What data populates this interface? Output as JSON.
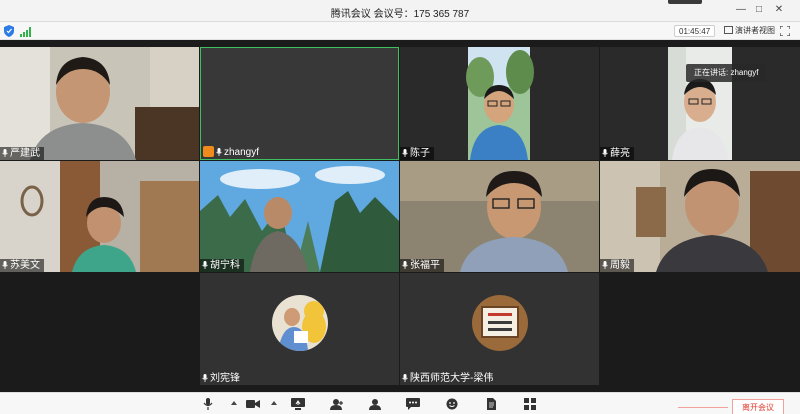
{
  "window": {
    "title": "腾讯会议 会议号：175 365 787"
  },
  "status": {
    "timer": "01:45:47",
    "speaker_view_label": "演讲者视图"
  },
  "speaking_indicator": "正在讲话: zhangyf",
  "participants": [
    {
      "name": "严建武"
    },
    {
      "name": "zhangyf"
    },
    {
      "name": "陈子"
    },
    {
      "name": "薛亮"
    },
    {
      "name": "苏美文"
    },
    {
      "name": "胡宁科"
    },
    {
      "name": "张福平"
    },
    {
      "name": "周毅"
    },
    {
      "name": "刘宪锋"
    },
    {
      "name": "陕西师范大学-梁伟"
    }
  ],
  "toolbar": {
    "end_meeting_label": "离开会议"
  },
  "colors": {
    "accent": "#f08a1c",
    "end_red": "#e03a2e",
    "active_border": "#3fbf5f"
  }
}
